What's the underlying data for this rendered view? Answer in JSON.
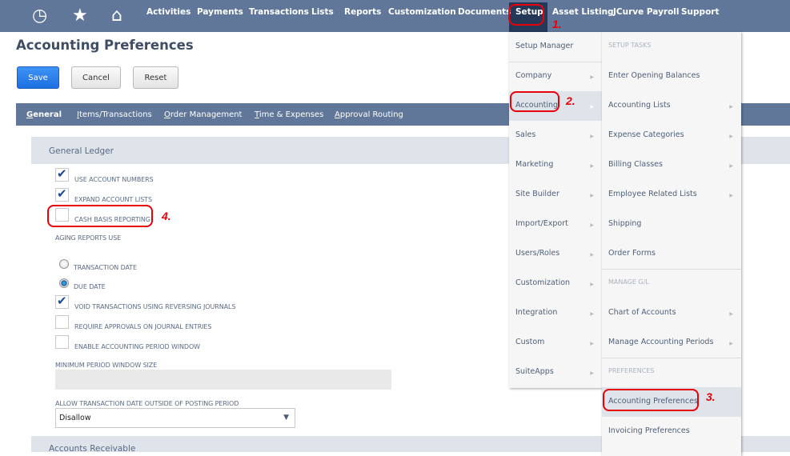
{
  "nav": {
    "icons": [
      "recent-icon",
      "star-icon",
      "home-icon"
    ],
    "items": [
      "Activities",
      "Payments",
      "Transactions",
      "Lists",
      "Reports",
      "Customization",
      "Documents",
      "Setup",
      "Asset Listing",
      "JCurve Payroll",
      "Support"
    ],
    "active": "Setup"
  },
  "page": {
    "title": "Accounting Preferences"
  },
  "buttons": {
    "save": "Save",
    "cancel": "Cancel",
    "reset": "Reset"
  },
  "tabs": [
    {
      "label": "General",
      "key": "G",
      "rest": "eneral"
    },
    {
      "key": "I",
      "rest": "tems/Transactions"
    },
    {
      "key": "O",
      "rest": "rder Management"
    },
    {
      "key": "T",
      "rest": "ime & Expenses"
    },
    {
      "key": "A",
      "rest": "pproval Routing"
    }
  ],
  "general_ledger": {
    "title": "General Ledger",
    "use_account_numbers": {
      "label": "USE ACCOUNT NUMBERS",
      "checked": true
    },
    "expand_account_lists": {
      "label": "EXPAND ACCOUNT LISTS",
      "checked": true
    },
    "cash_basis_reporting": {
      "label": "CASH BASIS REPORTING",
      "checked": false
    },
    "aging_label": "AGING REPORTS USE",
    "aging_options": [
      "TRANSACTION DATE",
      "DUE DATE"
    ],
    "aging_selected": "DUE DATE",
    "void_reversing": {
      "label": "VOID TRANSACTIONS USING REVERSING JOURNALS",
      "checked": true
    },
    "require_approvals": {
      "label": "REQUIRE APPROVALS ON JOURNAL ENTRIES",
      "checked": false
    },
    "enable_period_window": {
      "label": "ENABLE ACCOUNTING PERIOD WINDOW",
      "checked": false
    },
    "min_window_label": "MINIMUM PERIOD WINDOW SIZE",
    "min_window_value": "",
    "allow_date_label": "ALLOW TRANSACTION DATE OUTSIDE OF POSTING PERIOD",
    "allow_date_value": "Disallow"
  },
  "next_section": "Accounts Receivable",
  "setup_menu": [
    "Setup Manager",
    "Company",
    "Accounting",
    "Sales",
    "Marketing",
    "Site Builder",
    "Import/Export",
    "Users/Roles",
    "Customization",
    "Integration",
    "Custom",
    "SuiteApps"
  ],
  "accounting_menu": {
    "setup_tasks_header": "SETUP TASKS",
    "setup_tasks": [
      "Enter Opening Balances",
      "Accounting Lists",
      "Expense Categories",
      "Billing Classes",
      "Employee Related Lists",
      "Shipping",
      "Order Forms"
    ],
    "manage_gl_header": "MANAGE G/L",
    "manage_gl": [
      "Chart of Accounts",
      "Manage Accounting Periods"
    ],
    "preferences_header": "PREFERENCES",
    "preferences": [
      "Accounting Preferences",
      "Invoicing Preferences"
    ]
  },
  "annotations": [
    "1.",
    "2.",
    "3.",
    "4."
  ],
  "colors": {
    "nav": "#607799",
    "active_nav": "#253858",
    "save": "#1d6fe0",
    "annotation": "#e8000a"
  }
}
